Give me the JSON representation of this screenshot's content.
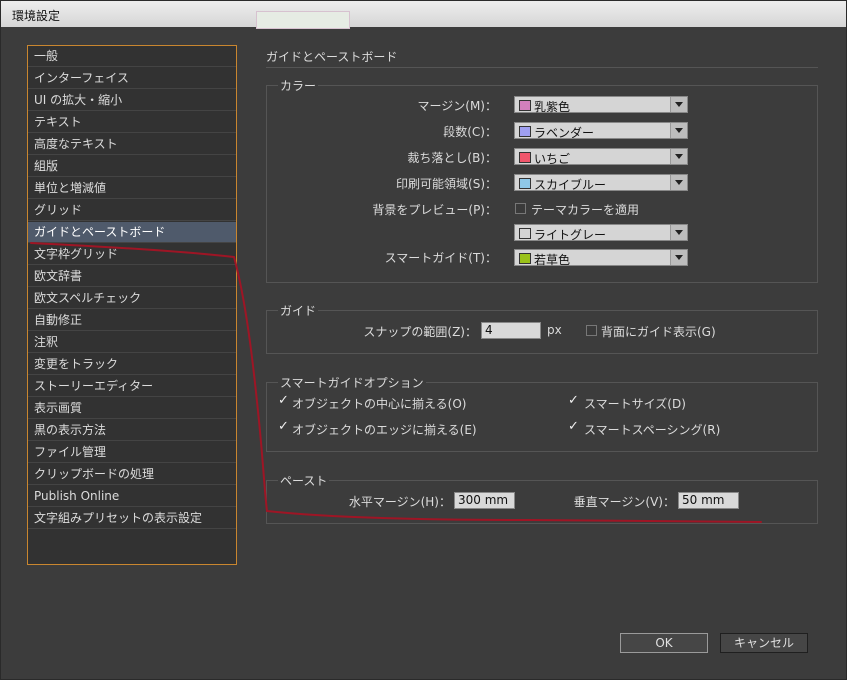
{
  "window": {
    "title": "環境設定"
  },
  "sidebar": {
    "items": [
      "一般",
      "インターフェイス",
      "UI の拡大・縮小",
      "テキスト",
      "高度なテキスト",
      "組版",
      "単位と増減値",
      "グリッド",
      "ガイドとペーストボード",
      "文字枠グリッド",
      "欧文辞書",
      "欧文スペルチェック",
      "自動修正",
      "注釈",
      "変更をトラック",
      "ストーリーエディター",
      "表示画質",
      "黒の表示方法",
      "ファイル管理",
      "クリップボードの処理",
      "Publish Online",
      "文字組みプリセットの表示設定"
    ],
    "selected_index": 8
  },
  "panel": {
    "title": "ガイドとペーストボード",
    "color_group": {
      "label": "カラー",
      "margin_label": "マージン(M)：",
      "margin_value": "乳紫色",
      "margin_color": "#d37fbd",
      "columns_label": "段数(C)：",
      "columns_value": "ラベンダー",
      "columns_color": "#9f9ff0",
      "bleed_label": "裁ち落とし(B)：",
      "bleed_value": "いちご",
      "bleed_color": "#f0566b",
      "slug_label": "印刷可能領域(S)：",
      "slug_value": "スカイブルー",
      "slug_color": "#8fc8e8",
      "preview_bg_label": "背景をプレビュー(P)：",
      "theme_checkbox_label": "テーマカラーを適用",
      "preview_value": "ライトグレー",
      "preview_color": "#d4d4d4",
      "smartguide_label": "スマートガイド(T)：",
      "smartguide_value": "若草色",
      "smartguide_color": "#9ac219"
    },
    "guide_group": {
      "label": "ガイド",
      "snap_label": "スナップの範囲(Z)：",
      "snap_value": "4",
      "snap_unit": "px",
      "back_label": "背面にガイド表示(G)",
      "back_checked": false
    },
    "smart_group": {
      "label": "スマートガイドオプション",
      "opt1": "オブジェクトの中心に揃える(O)",
      "opt2": "オブジェクトのエッジに揃える(E)",
      "opt3": "スマートサイズ(D)",
      "opt4": "スマートスペーシング(R)",
      "checkmark": "✓"
    },
    "paste_group": {
      "label": "ペースト",
      "h_label": "水平マージン(H)：",
      "h_value": "300 mm",
      "v_label": "垂直マージン(V)：",
      "v_value": "50 mm"
    }
  },
  "buttons": {
    "ok": "OK",
    "cancel": "キャンセル"
  },
  "annotation_color": "#9e1525"
}
